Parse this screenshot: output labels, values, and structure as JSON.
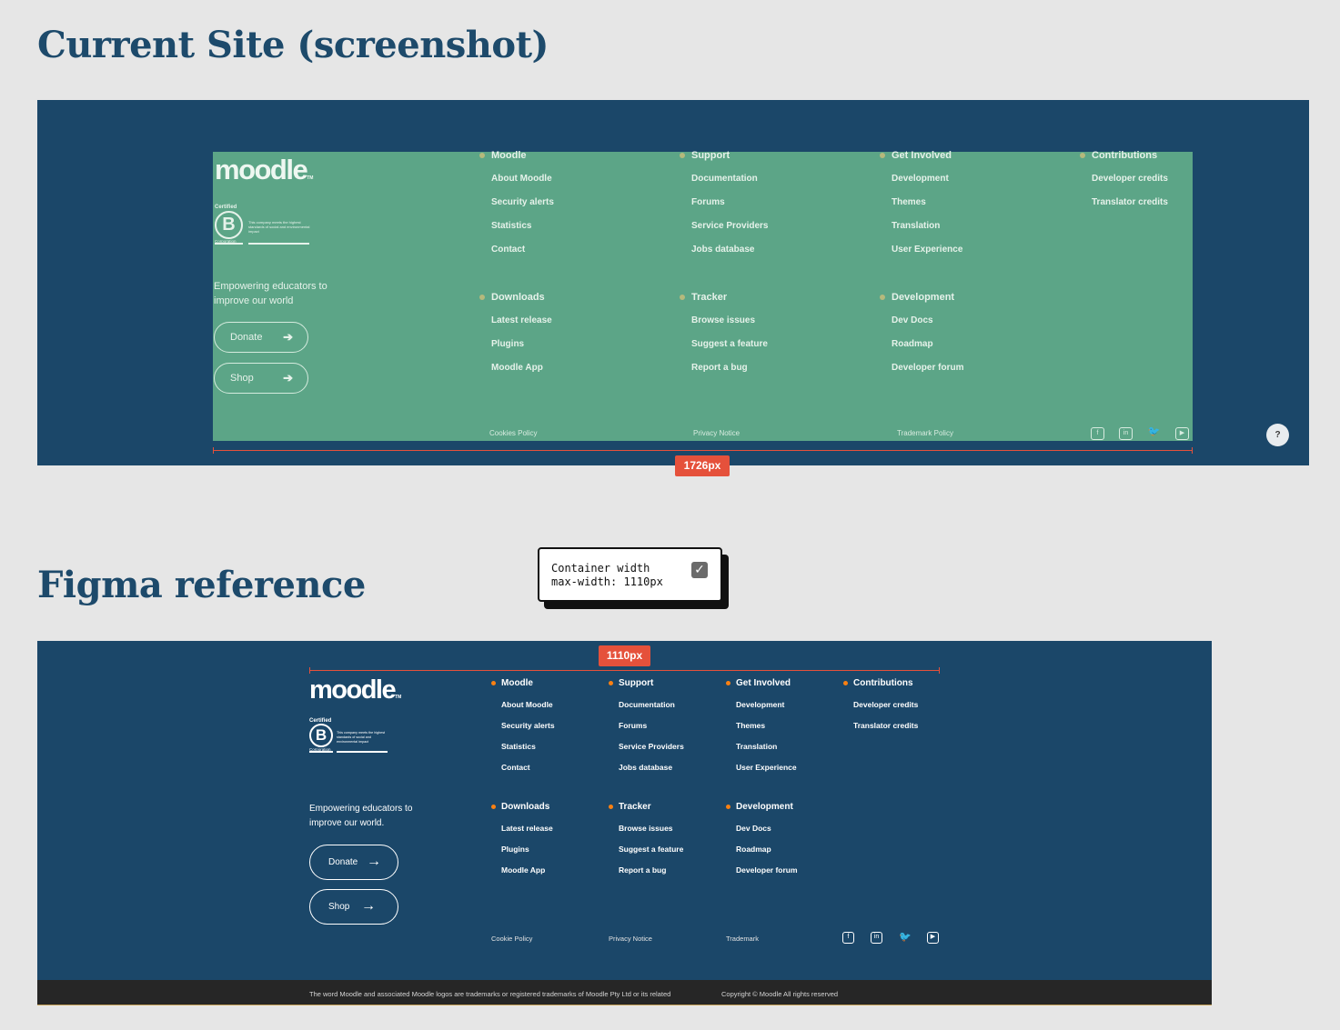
{
  "headings": {
    "current": "Current Site (screenshot)",
    "figma": "Figma reference"
  },
  "brand": {
    "logo": "moodle",
    "tm": "TM"
  },
  "bcorp": {
    "certified": "Certified",
    "letter": "B",
    "text": "This company meets the highest standards of social and environmental impact",
    "corporation": "Corporation"
  },
  "current": {
    "tagline": "Empowering educators to improve our world",
    "buttons": {
      "donate": "Donate",
      "shop": "Shop"
    },
    "columns": [
      {
        "title": "Moodle",
        "links": [
          "About Moodle",
          "Security alerts",
          "Statistics",
          "Contact"
        ]
      },
      {
        "title": "Support",
        "links": [
          "Documentation",
          "Forums",
          "Service Providers",
          "Jobs database"
        ]
      },
      {
        "title": "Get Involved",
        "links": [
          "Development",
          "Themes",
          "Translation",
          "User Experience"
        ]
      },
      {
        "title": "Contributions",
        "links": [
          "Developer credits",
          "Translator credits"
        ]
      },
      {
        "title": "Downloads",
        "links": [
          "Latest release",
          "Plugins",
          "Moodle App"
        ]
      },
      {
        "title": "Tracker",
        "links": [
          "Browse issues",
          "Suggest a feature",
          "Report a bug"
        ]
      },
      {
        "title": "Development",
        "links": [
          "Dev Docs",
          "Roadmap",
          "Developer forum"
        ]
      }
    ],
    "footer_links": {
      "cookies": "Cookies Policy",
      "privacy": "Privacy Notice",
      "trademark": "Trademark Policy"
    },
    "width_badge": "1726px",
    "help": "?"
  },
  "note": {
    "line1": "Container width",
    "line2": "max-width: 1110px",
    "checked": "✓"
  },
  "figma": {
    "width_badge": "1110px",
    "tagline": "Empowering educators to improve our world.",
    "buttons": {
      "donate": "Donate",
      "shop": "Shop"
    },
    "columns": [
      {
        "title": "Moodle",
        "links": [
          "About Moodle",
          "Security alerts",
          "Statistics",
          "Contact"
        ]
      },
      {
        "title": "Support",
        "links": [
          "Documentation",
          "Forums",
          "Service Providers",
          "Jobs database"
        ]
      },
      {
        "title": "Get Involved",
        "links": [
          "Development",
          "Themes",
          "Translation",
          "User Experience"
        ]
      },
      {
        "title": "Contributions",
        "links": [
          "Developer credits",
          "Translator credits"
        ]
      },
      {
        "title": "Downloads",
        "links": [
          "Latest release",
          "Plugins",
          "Moodle App"
        ]
      },
      {
        "title": "Tracker",
        "links": [
          "Browse issues",
          "Suggest a feature",
          "Report a bug"
        ]
      },
      {
        "title": "Development",
        "links": [
          "Dev Docs",
          "Roadmap",
          "Developer forum"
        ]
      }
    ],
    "footer_links": {
      "cookie": "Cookie Policy",
      "privacy": "Privacy Notice",
      "trademark": "Trademark"
    },
    "legal": "The word Moodle and associated Moodle logos are trademarks or registered trademarks of Moodle Pty Ltd or its related",
    "copyright": "Copyright © Moodle All rights reserved"
  },
  "social_icons": [
    "facebook-icon",
    "linkedin-icon",
    "twitter-icon",
    "youtube-icon"
  ],
  "arrow": "→",
  "colors": {
    "page": "#e6e6e6",
    "panel": "#1b4769",
    "green_overlay": "#5ca587",
    "accent": "#f98012",
    "ruler": "#e5513b",
    "bottom_bar": "#262626"
  }
}
